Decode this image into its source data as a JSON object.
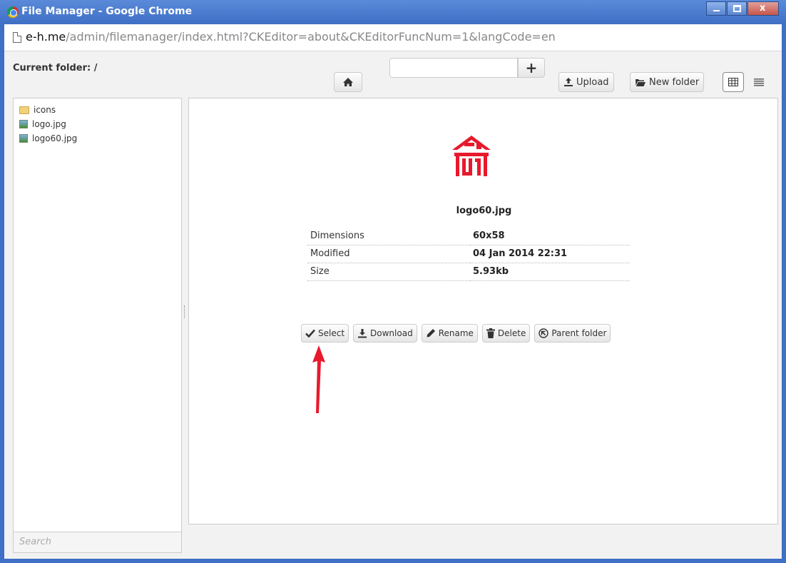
{
  "window": {
    "title": "File Manager - Google Chrome"
  },
  "address": {
    "host": "e-h.me",
    "path": "/admin/filemanager/index.html?CKEditor=about&CKEditorFuncNum=1&langCode=en"
  },
  "toolbar": {
    "current_folder_label": "Current folder: /",
    "newfolder_input_value": "",
    "upload_label": "Upload",
    "new_folder_label": "New folder",
    "plus_label": "+"
  },
  "tree": {
    "items": [
      {
        "label": "icons",
        "icon": "folder-icon"
      },
      {
        "label": "logo.jpg",
        "icon": "image-icon"
      },
      {
        "label": "logo60.jpg",
        "icon": "image-icon"
      }
    ]
  },
  "search": {
    "placeholder": "Search"
  },
  "preview": {
    "file_name": "logo60.jpg",
    "details": [
      {
        "key": "Dimensions",
        "value": "60x58"
      },
      {
        "key": "Modified",
        "value": "04 Jan 2014 22:31"
      },
      {
        "key": "Size",
        "value": "5.93kb"
      }
    ]
  },
  "actions": {
    "select": "Select",
    "download": "Download",
    "rename": "Rename",
    "delete": "Delete",
    "parent_folder": "Parent folder"
  },
  "colors": {
    "title_bar": "#3f6fc6",
    "logo_red": "#e8192c",
    "annotation_arrow": "#e8192c"
  }
}
